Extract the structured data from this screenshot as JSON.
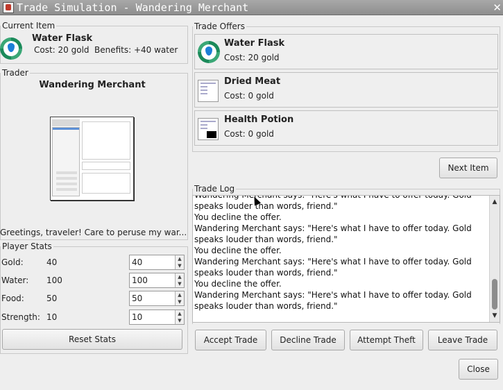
{
  "window": {
    "title": "Trade Simulation - Wandering Merchant",
    "close_glyph": "✕"
  },
  "current_item": {
    "legend": "Current Item",
    "name": "Water Flask",
    "cost": "Cost: 20 gold",
    "benefits": "Benefits: +40 water",
    "icon": "water-drop-icon"
  },
  "trader": {
    "legend": "Trader",
    "name": "Wandering Merchant",
    "greeting": "Greetings, traveler! Care to peruse my war..."
  },
  "player_stats": {
    "legend": "Player Stats",
    "stats": [
      {
        "label": "Gold:",
        "value": "40",
        "input": "40"
      },
      {
        "label": "Water:",
        "value": "100",
        "input": "100"
      },
      {
        "label": "Food:",
        "value": "50",
        "input": "50"
      },
      {
        "label": "Strength:",
        "value": "10",
        "input": "10"
      }
    ],
    "reset_label": "Reset Stats"
  },
  "trade_offers": {
    "legend": "Trade Offers",
    "offers": [
      {
        "name": "Water Flask",
        "cost": "Cost: 20 gold",
        "icon": "water-drop-icon"
      },
      {
        "name": "Dried Meat",
        "cost": "Cost: 0 gold",
        "icon": "document-thumbnail-icon"
      },
      {
        "name": "Health Potion",
        "cost": "Cost: 0 gold",
        "icon": "document-thumbnail-icon"
      }
    ],
    "next_label": "Next Item"
  },
  "trade_log": {
    "legend": "Trade Log",
    "lines": [
      "Wandering Merchant says: \"Here's what I have to offer today. Gold",
      "speaks louder than words, friend.\"",
      "You decline the offer.",
      "Wandering Merchant says: \"Here's what I have to offer today. Gold",
      "speaks louder than words, friend.\"",
      "You decline the offer.",
      "Wandering Merchant says: \"Here's what I have to offer today. Gold",
      "speaks louder than words, friend.\"",
      "You decline the offer.",
      "Wandering Merchant says: \"Here's what I have to offer today. Gold",
      "speaks louder than words, friend.\""
    ]
  },
  "actions": {
    "accept": "Accept Trade",
    "decline": "Decline Trade",
    "theft": "Attempt Theft",
    "leave": "Leave Trade",
    "close": "Close"
  }
}
